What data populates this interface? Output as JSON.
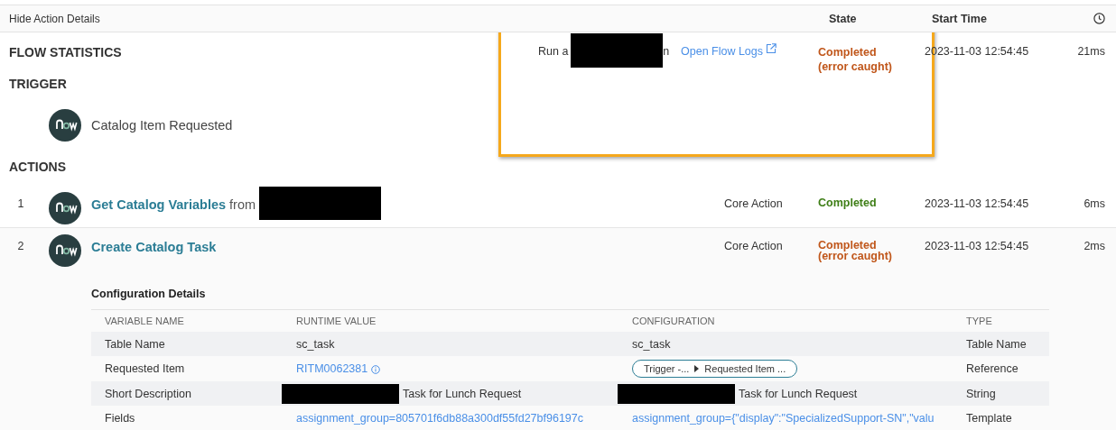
{
  "toolbar": {
    "toggle_label": "Hide Action Details",
    "columns": [
      "State",
      "Start Time"
    ]
  },
  "flow_statistics": {
    "heading": "FLOW STATISTICS",
    "run_as": {
      "before": "Run a",
      "redacted": true,
      "after": "n"
    },
    "link": "Open Flow Logs",
    "state": {
      "label": "Completed",
      "note": "(error caught)",
      "color": "#c0561a"
    },
    "start_time": "2023-11-03 12:54:45",
    "duration": "21ms"
  },
  "annotation": {
    "kind": "highlight_box"
  },
  "trigger": {
    "heading": "TRIGGER",
    "name": "Catalog Item Requested"
  },
  "actions": {
    "heading": "ACTIONS",
    "items": [
      {
        "number": "1",
        "title": "Get Catalog Variables",
        "suffix": "from",
        "suffix_redacted": true,
        "type": "Core Action",
        "state": {
          "label": "Completed",
          "color": "#3e7e16"
        },
        "start_time": "2023-11-03 12:54:45",
        "duration": "6ms",
        "expanded": false
      },
      {
        "number": "2",
        "title": "Create Catalog Task",
        "type": "Core Action",
        "state": {
          "label": "Completed",
          "note": "(error caught)",
          "color": "#c0561a"
        },
        "start_time": "2023-11-03 12:54:45",
        "duration": "2ms",
        "expanded": true,
        "details": {
          "heading": "Configuration Details",
          "columns": [
            "VARIABLE NAME",
            "RUNTIME VALUE",
            "CONFIGURATION",
            "TYPE"
          ],
          "rows": [
            {
              "variable": "Table Name",
              "runtime": {
                "kind": "text",
                "text": "sc_task"
              },
              "configuration": {
                "kind": "text",
                "text": "sc_task"
              },
              "type": "Table Name"
            },
            {
              "variable": "Requested Item",
              "runtime": {
                "kind": "link_info",
                "text": "RITM0062381"
              },
              "configuration": {
                "kind": "pill",
                "parts": [
                  "Trigger -...",
                  "Requested Item ..."
                ]
              },
              "type": "Reference"
            },
            {
              "variable": "Short Description",
              "runtime": {
                "kind": "redacted_text",
                "text": "Task for Lunch Request"
              },
              "configuration": {
                "kind": "redacted_text",
                "text": "Task for Lunch Request"
              },
              "type": "String"
            },
            {
              "variable": "Fields",
              "runtime": {
                "kind": "link",
                "text": "assignment_group=805701f6db88a300df55fd27bf96197c"
              },
              "configuration": {
                "kind": "link",
                "text": "assignment_group={\"display\":\"SpecializedSupport-SN\",\"valu"
              },
              "type": "Template"
            }
          ]
        }
      }
    ]
  }
}
